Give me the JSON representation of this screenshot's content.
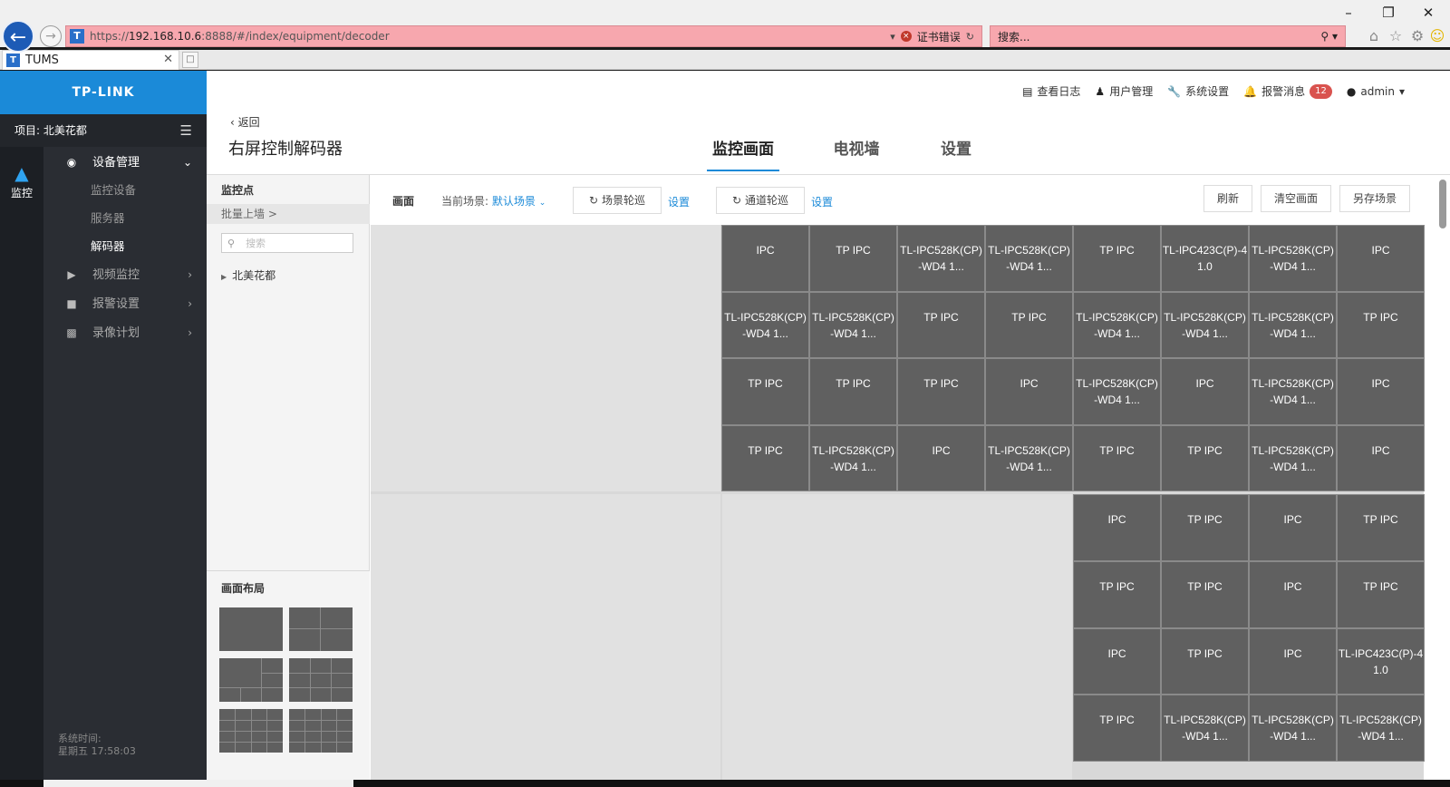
{
  "browser": {
    "url_prefix": "https://",
    "url_host": "192.168.10.6",
    "url_rest": ":8888/#/index/equipment/decoder",
    "cert_error": "证书错误",
    "search_placeholder": "搜索...",
    "tab_title": "TUMS"
  },
  "header": {
    "logo": "TP-LINK",
    "nav": [
      {
        "label": "查看日志"
      },
      {
        "label": "用户管理"
      },
      {
        "label": "系统设置"
      },
      {
        "label": "报警消息",
        "badge": "12"
      },
      {
        "label": "admin"
      }
    ]
  },
  "sidebar": {
    "rail_label": "监控",
    "project_label": "项目: 北美花都",
    "menu": [
      {
        "label": "设备管理"
      },
      {
        "label": "视频监控"
      },
      {
        "label": "报警设置"
      },
      {
        "label": "录像计划"
      }
    ],
    "submenu": [
      {
        "label": "监控设备"
      },
      {
        "label": "服务器"
      },
      {
        "label": "解码器"
      }
    ],
    "system_time_label": "系统时间:",
    "system_time_value": "星期五 17:58:03"
  },
  "page": {
    "back_label": "返回",
    "title": "右屏控制解码器",
    "tabs": [
      {
        "label": "监控画面"
      },
      {
        "label": "电视墙"
      },
      {
        "label": "设置"
      }
    ]
  },
  "tree": {
    "heading": "监控点",
    "batch_label": "批量上墙 >",
    "search_placeholder": "搜索",
    "node_label": "北美花都",
    "layout_title": "画面布局"
  },
  "toolbar": {
    "screen_label": "画面",
    "scene_label": "当前场景:",
    "scene_value": "默认场景",
    "scene_cycle": "场景轮巡",
    "channel_cycle": "通道轮巡",
    "settings_link": "设置",
    "refresh": "刷新",
    "clear": "清空画面",
    "save_as": "另存场景"
  },
  "wall": {
    "block_left": [
      [
        "IPC",
        "TP IPC",
        "TL-IPC528K(CP)\n-WD4 1...",
        "TL-IPC528K(CP)\n-WD4 1..."
      ],
      [
        "TL-IPC528K(CP)\n-WD4 1...",
        "TL-IPC528K(CP)\n-WD4 1...",
        "TP IPC",
        "TP IPC"
      ],
      [
        "TP IPC",
        "TP IPC",
        "TP IPC",
        "IPC"
      ],
      [
        "TP IPC",
        "TL-IPC528K(CP)\n-WD4 1...",
        "IPC",
        "TL-IPC528K(CP)\n-WD4 1..."
      ]
    ],
    "block_right_top": [
      [
        "TP IPC",
        "TL-IPC423C(P)-4\n1.0",
        "TL-IPC528K(CP)\n-WD4 1...",
        "IPC"
      ],
      [
        "TL-IPC528K(CP)\n-WD4 1...",
        "TL-IPC528K(CP)\n-WD4 1...",
        "TL-IPC528K(CP)\n-WD4 1...",
        "TP IPC"
      ],
      [
        "TL-IPC528K(CP)\n-WD4 1...",
        "IPC",
        "TL-IPC528K(CP)\n-WD4 1...",
        "IPC"
      ],
      [
        "TP IPC",
        "TP IPC",
        "TL-IPC528K(CP)\n-WD4 1...",
        "IPC"
      ]
    ],
    "block_right_bottom": [
      [
        "IPC",
        "TP IPC",
        "IPC",
        "TP IPC"
      ],
      [
        "TP IPC",
        "TP IPC",
        "IPC",
        "TP IPC"
      ],
      [
        "IPC",
        "TP IPC",
        "IPC",
        "TL-IPC423C(P)-4\n1.0"
      ],
      [
        "TP IPC",
        "TL-IPC528K(CP)\n-WD4 1...",
        "TL-IPC528K(CP)\n-WD4 1...",
        "TL-IPC528K(CP)\n-WD4 1..."
      ]
    ]
  },
  "icons": {
    "back": "arrow-left-icon",
    "forward": "arrow-right-icon",
    "log": "document-icon",
    "user": "users-icon",
    "settings": "wrench-icon",
    "alarm": "bell-icon",
    "admin": "person-icon"
  },
  "colors": {
    "brand": "#1b8ad8",
    "sidebar": "#2a2d33",
    "cell": "#606060",
    "badge": "#d9534f",
    "address_error": "#f7a7ae"
  }
}
